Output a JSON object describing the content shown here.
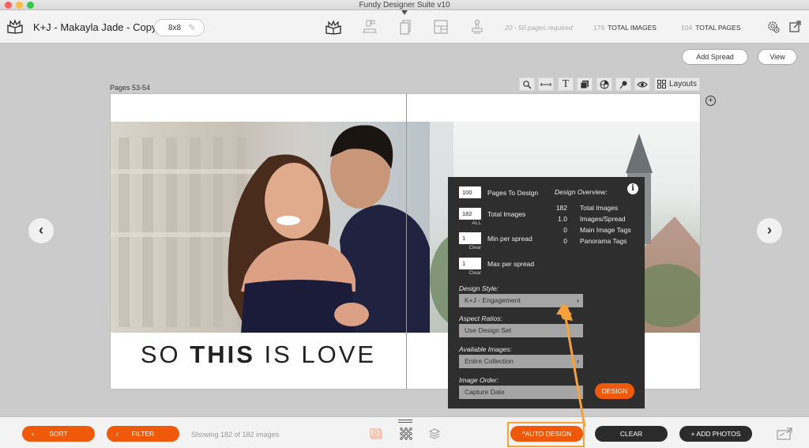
{
  "window": {
    "title": "Fundy Designer Suite v10"
  },
  "toolbar": {
    "app_icon": "album-book-icon",
    "project_name": "K+J - Makayla Jade - Copy",
    "album_size": "8x8",
    "edit_icon": "pencil-icon",
    "modes": [
      {
        "name": "album-designer",
        "icon": "album-book-icon",
        "active": true
      },
      {
        "name": "wall-designer",
        "icon": "wall-frame-icon",
        "active": false
      },
      {
        "name": "card-designer",
        "icon": "card-pages-icon",
        "active": false
      },
      {
        "name": "image-box-designer",
        "icon": "layout-grid-icon",
        "active": false
      },
      {
        "name": "print-products",
        "icon": "stamp-icon",
        "active": false
      }
    ],
    "pages_required": "20 - 50 pages required",
    "total_images_count": "179",
    "total_images_label": "TOTAL IMAGES",
    "total_pages_count": "104",
    "total_pages_label": "TOTAL PAGES",
    "settings_icon": "gear-icon",
    "export_icon": "external-link-icon"
  },
  "actions": {
    "add_spread": "Add Spread",
    "view": "View"
  },
  "spread": {
    "pages_label": "Pages 53-54",
    "caption_pre": "SO ",
    "caption_bold": "THIS",
    "caption_post": " IS LOVE"
  },
  "tools": {
    "layouts_label": "Layouts",
    "items": [
      "zoom-icon",
      "spacing-icon",
      "text-icon",
      "layers-icon",
      "color-wheel-icon",
      "pin-icon",
      "eye-icon",
      "layouts-grid-icon"
    ]
  },
  "auto_design_panel": {
    "pages_to_design": {
      "value": "100",
      "label": "Pages To Design"
    },
    "total_images": {
      "value": "182",
      "label": "Total Images",
      "sub": "ALL"
    },
    "min_per_spread": {
      "value": "1",
      "label": "Min per spread",
      "sub": "Clear"
    },
    "max_per_spread": {
      "value": "1",
      "label": "Max per spread",
      "sub": "Clear"
    },
    "overview": {
      "title": "Design Overview:",
      "rows": [
        {
          "num": "182",
          "label": "Total Images"
        },
        {
          "num": "1.0",
          "label": "Images/Spread"
        },
        {
          "num": "0",
          "label": "Main Image Tags"
        },
        {
          "num": "0",
          "label": "Panorama Tags"
        }
      ]
    },
    "design_style": {
      "label": "Design Style:",
      "value": "K+J - Engagement"
    },
    "aspect_ratios": {
      "label": "Aspect Ratios:",
      "value": "Use Design Set"
    },
    "available_images": {
      "label": "Available Images:",
      "value": "Entire Collection"
    },
    "image_order": {
      "label": "Image Order:",
      "value": "Capture Date"
    },
    "design_button": "DESIGN"
  },
  "bottombar": {
    "sort": "SORT",
    "filter": "FILTER",
    "showing": "Showing 182 of 182 images",
    "auto_design": "^AUTO DESIGN",
    "clear": "CLEAR",
    "add_photos": "+ ADD PHOTOS"
  },
  "colors": {
    "accent": "#f0580a",
    "highlight": "#f7a13a",
    "panel_bg": "#2e2e2e"
  }
}
